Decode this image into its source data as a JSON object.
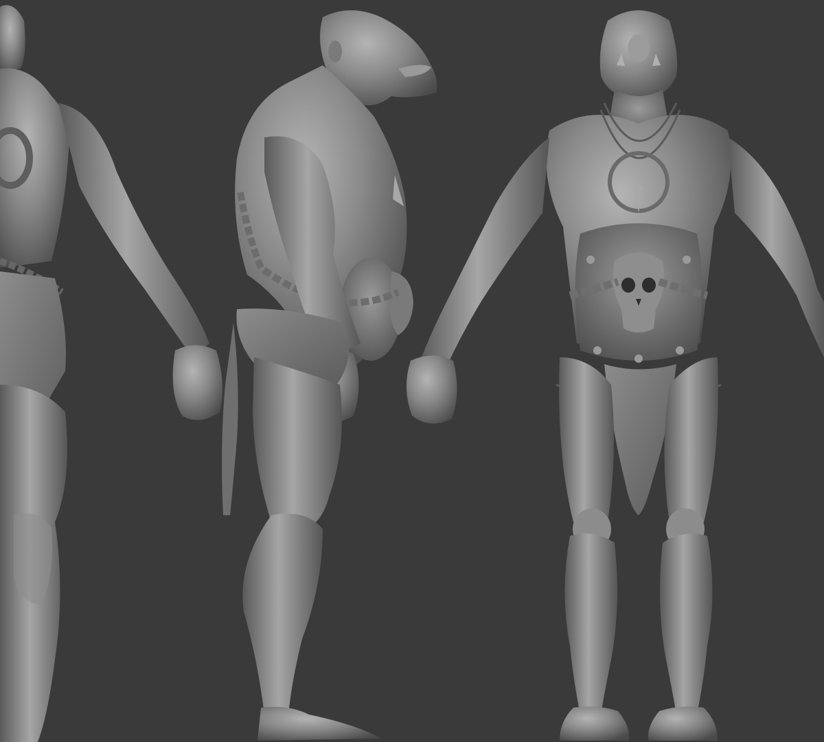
{
  "scene": {
    "background_color": "#3a3a3a",
    "clay_color": "#8a8a8a",
    "clay_highlight": "#b4b4b4",
    "clay_shadow": "#3e3e3e",
    "views": [
      {
        "name": "back-view",
        "icon": "ogre-back-figure"
      },
      {
        "name": "side-view",
        "icon": "ogre-side-figure"
      },
      {
        "name": "front-view",
        "icon": "ogre-front-figure"
      }
    ]
  }
}
